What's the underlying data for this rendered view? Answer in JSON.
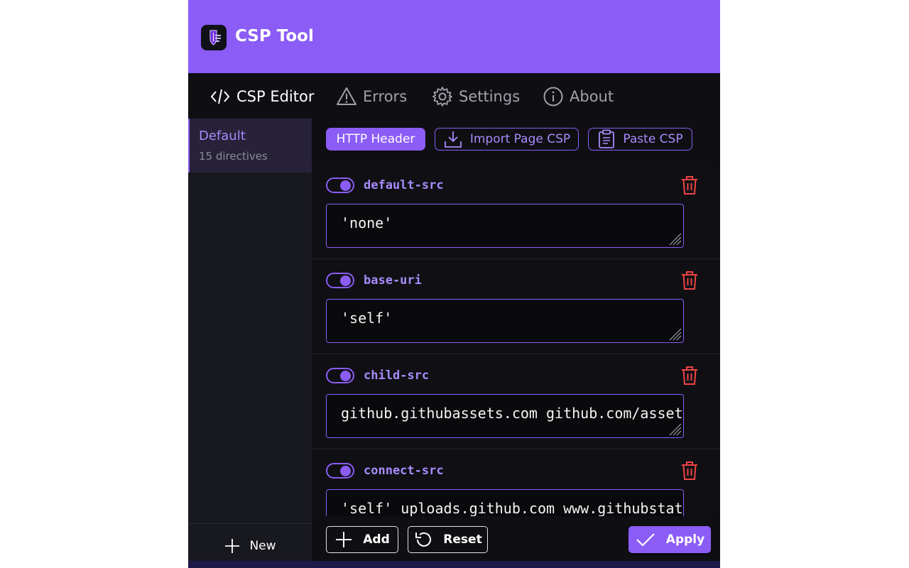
{
  "app": {
    "title": "CSP Tool"
  },
  "nav": [
    {
      "label": "CSP Editor",
      "icon": "code-icon",
      "active": true
    },
    {
      "label": "Errors",
      "icon": "warning-icon",
      "active": false
    },
    {
      "label": "Settings",
      "icon": "gear-icon",
      "active": false
    },
    {
      "label": "About",
      "icon": "info-icon",
      "active": false
    }
  ],
  "sidebar": {
    "profile": {
      "name": "Default",
      "subtitle": "15 directives"
    },
    "new_label": "New"
  },
  "toolbar": {
    "http_header": "HTTP Header",
    "import": "Import Page CSP",
    "paste": "Paste CSP"
  },
  "directives": [
    {
      "name": "default-src",
      "value": "'none'",
      "enabled": true
    },
    {
      "name": "base-uri",
      "value": "'self'",
      "enabled": true
    },
    {
      "name": "child-src",
      "value": "github.githubassets.com github.com/asset",
      "enabled": true
    },
    {
      "name": "connect-src",
      "value": "'self' uploads.github.com www.githubstat",
      "enabled": true
    }
  ],
  "actions": {
    "add": "Add",
    "reset": "Reset",
    "apply": "Apply"
  },
  "colors": {
    "accent": "#8b5cf6",
    "accent_light": "#a78bfa",
    "danger": "#ef4444",
    "background": "#0f0f13"
  }
}
